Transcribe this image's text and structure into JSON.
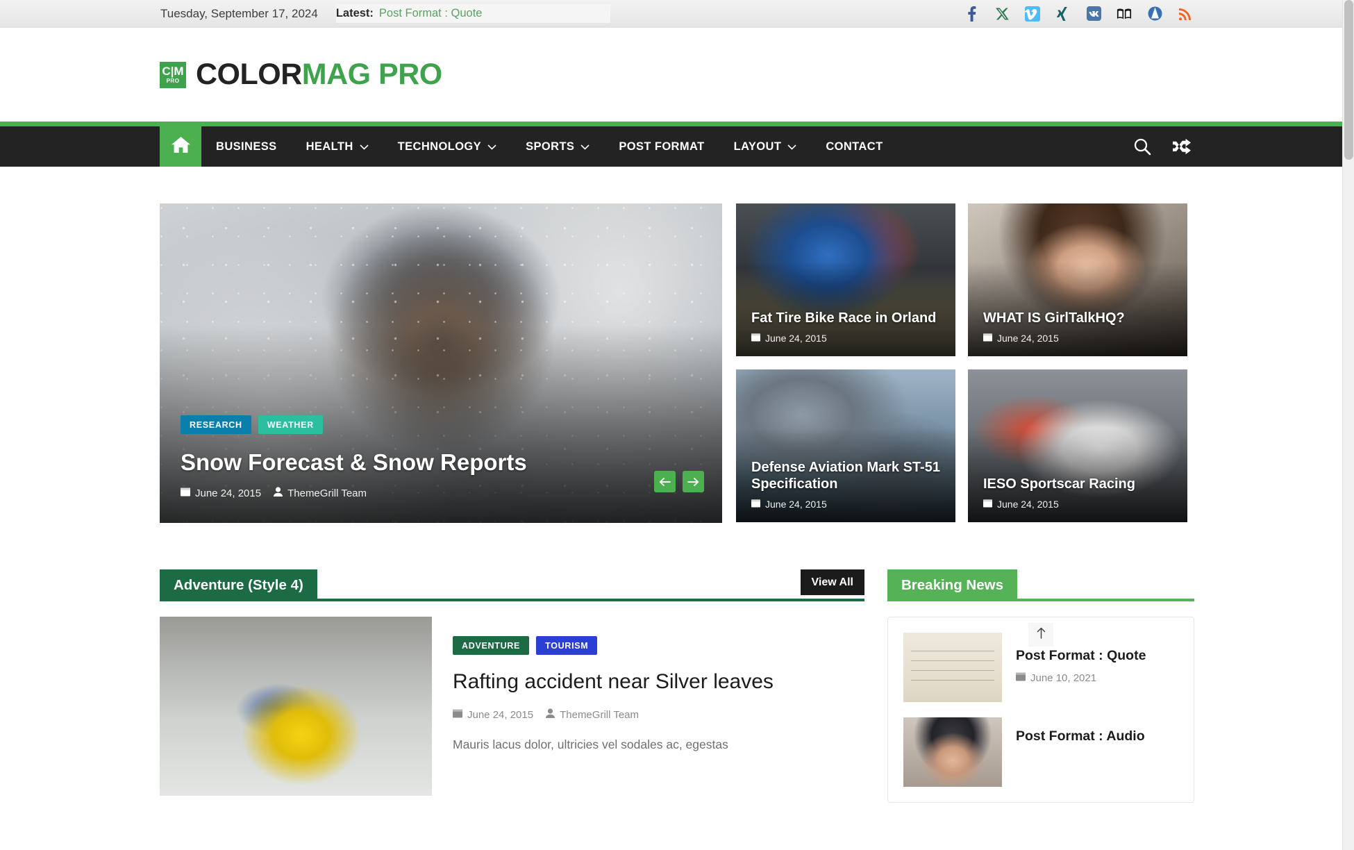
{
  "topbar": {
    "date": "Tuesday, September 17, 2024",
    "latest_label": "Latest:",
    "latest_link": "Post Format : Quote",
    "socials": [
      {
        "name": "facebook-icon",
        "label": "Facebook"
      },
      {
        "name": "x-twitter-icon",
        "label": "X"
      },
      {
        "name": "vimeo-icon",
        "label": "Vimeo"
      },
      {
        "name": "xing-icon",
        "label": "Xing"
      },
      {
        "name": "vk-icon",
        "label": "VK"
      },
      {
        "name": "book-icon",
        "label": "Book"
      },
      {
        "name": "peace-icon",
        "label": "Peace"
      },
      {
        "name": "rss-icon",
        "label": "RSS"
      }
    ]
  },
  "brand": {
    "mark_top": "C|M",
    "mark_bottom": "PRO",
    "name_dark": "COLOR",
    "name_green": "MAG PRO"
  },
  "nav": {
    "home_icon": "home-icon",
    "items": [
      {
        "label": "BUSINESS",
        "has_dropdown": false
      },
      {
        "label": "HEALTH",
        "has_dropdown": true
      },
      {
        "label": "TECHNOLOGY",
        "has_dropdown": true
      },
      {
        "label": "SPORTS",
        "has_dropdown": true
      },
      {
        "label": "POST FORMAT",
        "has_dropdown": false
      },
      {
        "label": "LAYOUT",
        "has_dropdown": true
      },
      {
        "label": "CONTACT",
        "has_dropdown": false
      }
    ],
    "search_icon": "search-icon",
    "random_icon": "shuffle-icon"
  },
  "featured": {
    "main": {
      "categories": [
        {
          "label": "RESEARCH",
          "color": "#0b7fab"
        },
        {
          "label": "WEATHER",
          "color": "#2bbfa0"
        }
      ],
      "title": "Snow Forecast & Snow Reports",
      "date": "June 24, 2015",
      "author": "ThemeGrill Team",
      "prev_label": "Previous slide",
      "next_label": "Next slide"
    },
    "tiles": [
      {
        "title": "Fat Tire Bike Race in Orland",
        "date": "June 24, 2015",
        "art": "img-moto"
      },
      {
        "title": "WHAT IS GirlTalkHQ?",
        "date": "June 24, 2015",
        "art": "img-girl"
      },
      {
        "title": "Defense Aviation Mark ST-51 Specification",
        "date": "June 24, 2015",
        "art": "img-jet"
      },
      {
        "title": "IESO Sportscar Racing",
        "date": "June 24, 2015",
        "art": "img-rally"
      }
    ]
  },
  "adventure_section": {
    "title": "Adventure (Style 4)",
    "title_bg": "#1d6b45",
    "rule_color": "#1d6b45",
    "view_all": "View All",
    "article": {
      "categories": [
        {
          "label": "ADVENTURE",
          "color": "#1d6b45"
        },
        {
          "label": "TOURISM",
          "color": "#2b3fd4"
        }
      ],
      "title": "Rafting accident near Silver leaves",
      "date": "June 24, 2015",
      "author": "ThemeGrill Team",
      "excerpt": "Mauris lacus dolor, ultricies vel sodales ac, egestas"
    }
  },
  "breaking_news": {
    "title": "Breaking News",
    "title_bg": "#56b256",
    "rule_color": "#56b256",
    "to_top_icon": "arrow-up-icon",
    "items": [
      {
        "title": "Post Format : Quote",
        "date": "June 10, 2021",
        "art": "img-note"
      },
      {
        "title": "Post Format : Audio",
        "date": "",
        "art": "img-audio"
      }
    ]
  }
}
